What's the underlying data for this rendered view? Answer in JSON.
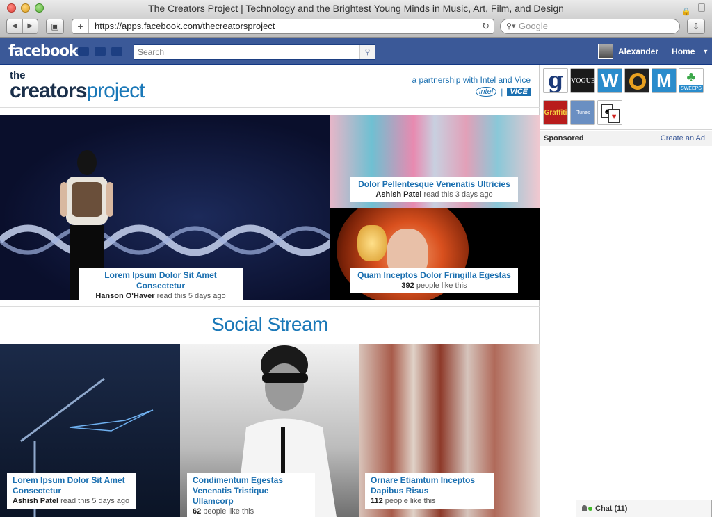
{
  "window": {
    "title": "The Creators Project | Technology and the Brightest Young Minds in Music, Art, Film, and Design"
  },
  "toolbar": {
    "url": "https://apps.facebook.com/thecreatorsproject",
    "search_placeholder": "Google"
  },
  "facebook": {
    "logo": "facebook",
    "search_placeholder": "Search",
    "user_name": "Alexander",
    "home_label": "Home"
  },
  "app": {
    "brand_the": "the",
    "brand_creators": "creators",
    "brand_project": "project",
    "partnership": "a partnership with Intel and Vice",
    "intel": "intel",
    "vice": "VICE",
    "featured": [
      {
        "title": "Lorem Ipsum Dolor Sit Amet Consectetur",
        "meta_name": "Hanson O'Haver",
        "meta_text": " read this 5 days ago"
      },
      {
        "title": "Dolor Pellentesque Venenatis Ultricies",
        "meta_name": "Ashish Patel",
        "meta_text": " read this 3 days ago"
      },
      {
        "title": "Quam Inceptos Dolor Fringilla Egestas",
        "meta_name": "392",
        "meta_text": " people like this"
      }
    ],
    "stream_title": "Social Stream",
    "stream": [
      {
        "title_line1": "Lorem Ipsum Dolor Sit Amet",
        "title_line2": "Consectetur",
        "meta_name": "Ashish Patel",
        "meta_text": " read this 5 days ago"
      },
      {
        "title_line1": "Condimentum Egestas",
        "title_line2": "Venenatis Tristique Ullamcorp",
        "meta_name": "62",
        "meta_text": " people like this"
      },
      {
        "title_line1": "Ornare Etiamtum Inceptos",
        "title_line2": "Dapibus Risus",
        "meta_name": "112",
        "meta_text": " people like this"
      }
    ]
  },
  "sidebar": {
    "bookmarks": [
      {
        "label": "g"
      },
      {
        "label": "VOGUE"
      },
      {
        "label": "W"
      },
      {
        "label": ""
      },
      {
        "label": "M"
      },
      {
        "label": "SWEEPS"
      },
      {
        "label": "Graffiti"
      },
      {
        "label": "iTunes"
      },
      {
        "label": ""
      }
    ],
    "sponsored_label": "Sponsored",
    "create_ad_label": "Create an Ad"
  },
  "chat": {
    "label": "Chat (11)"
  },
  "colors": {
    "fb_blue": "#3b5998",
    "link_blue": "#1a6fb0"
  }
}
